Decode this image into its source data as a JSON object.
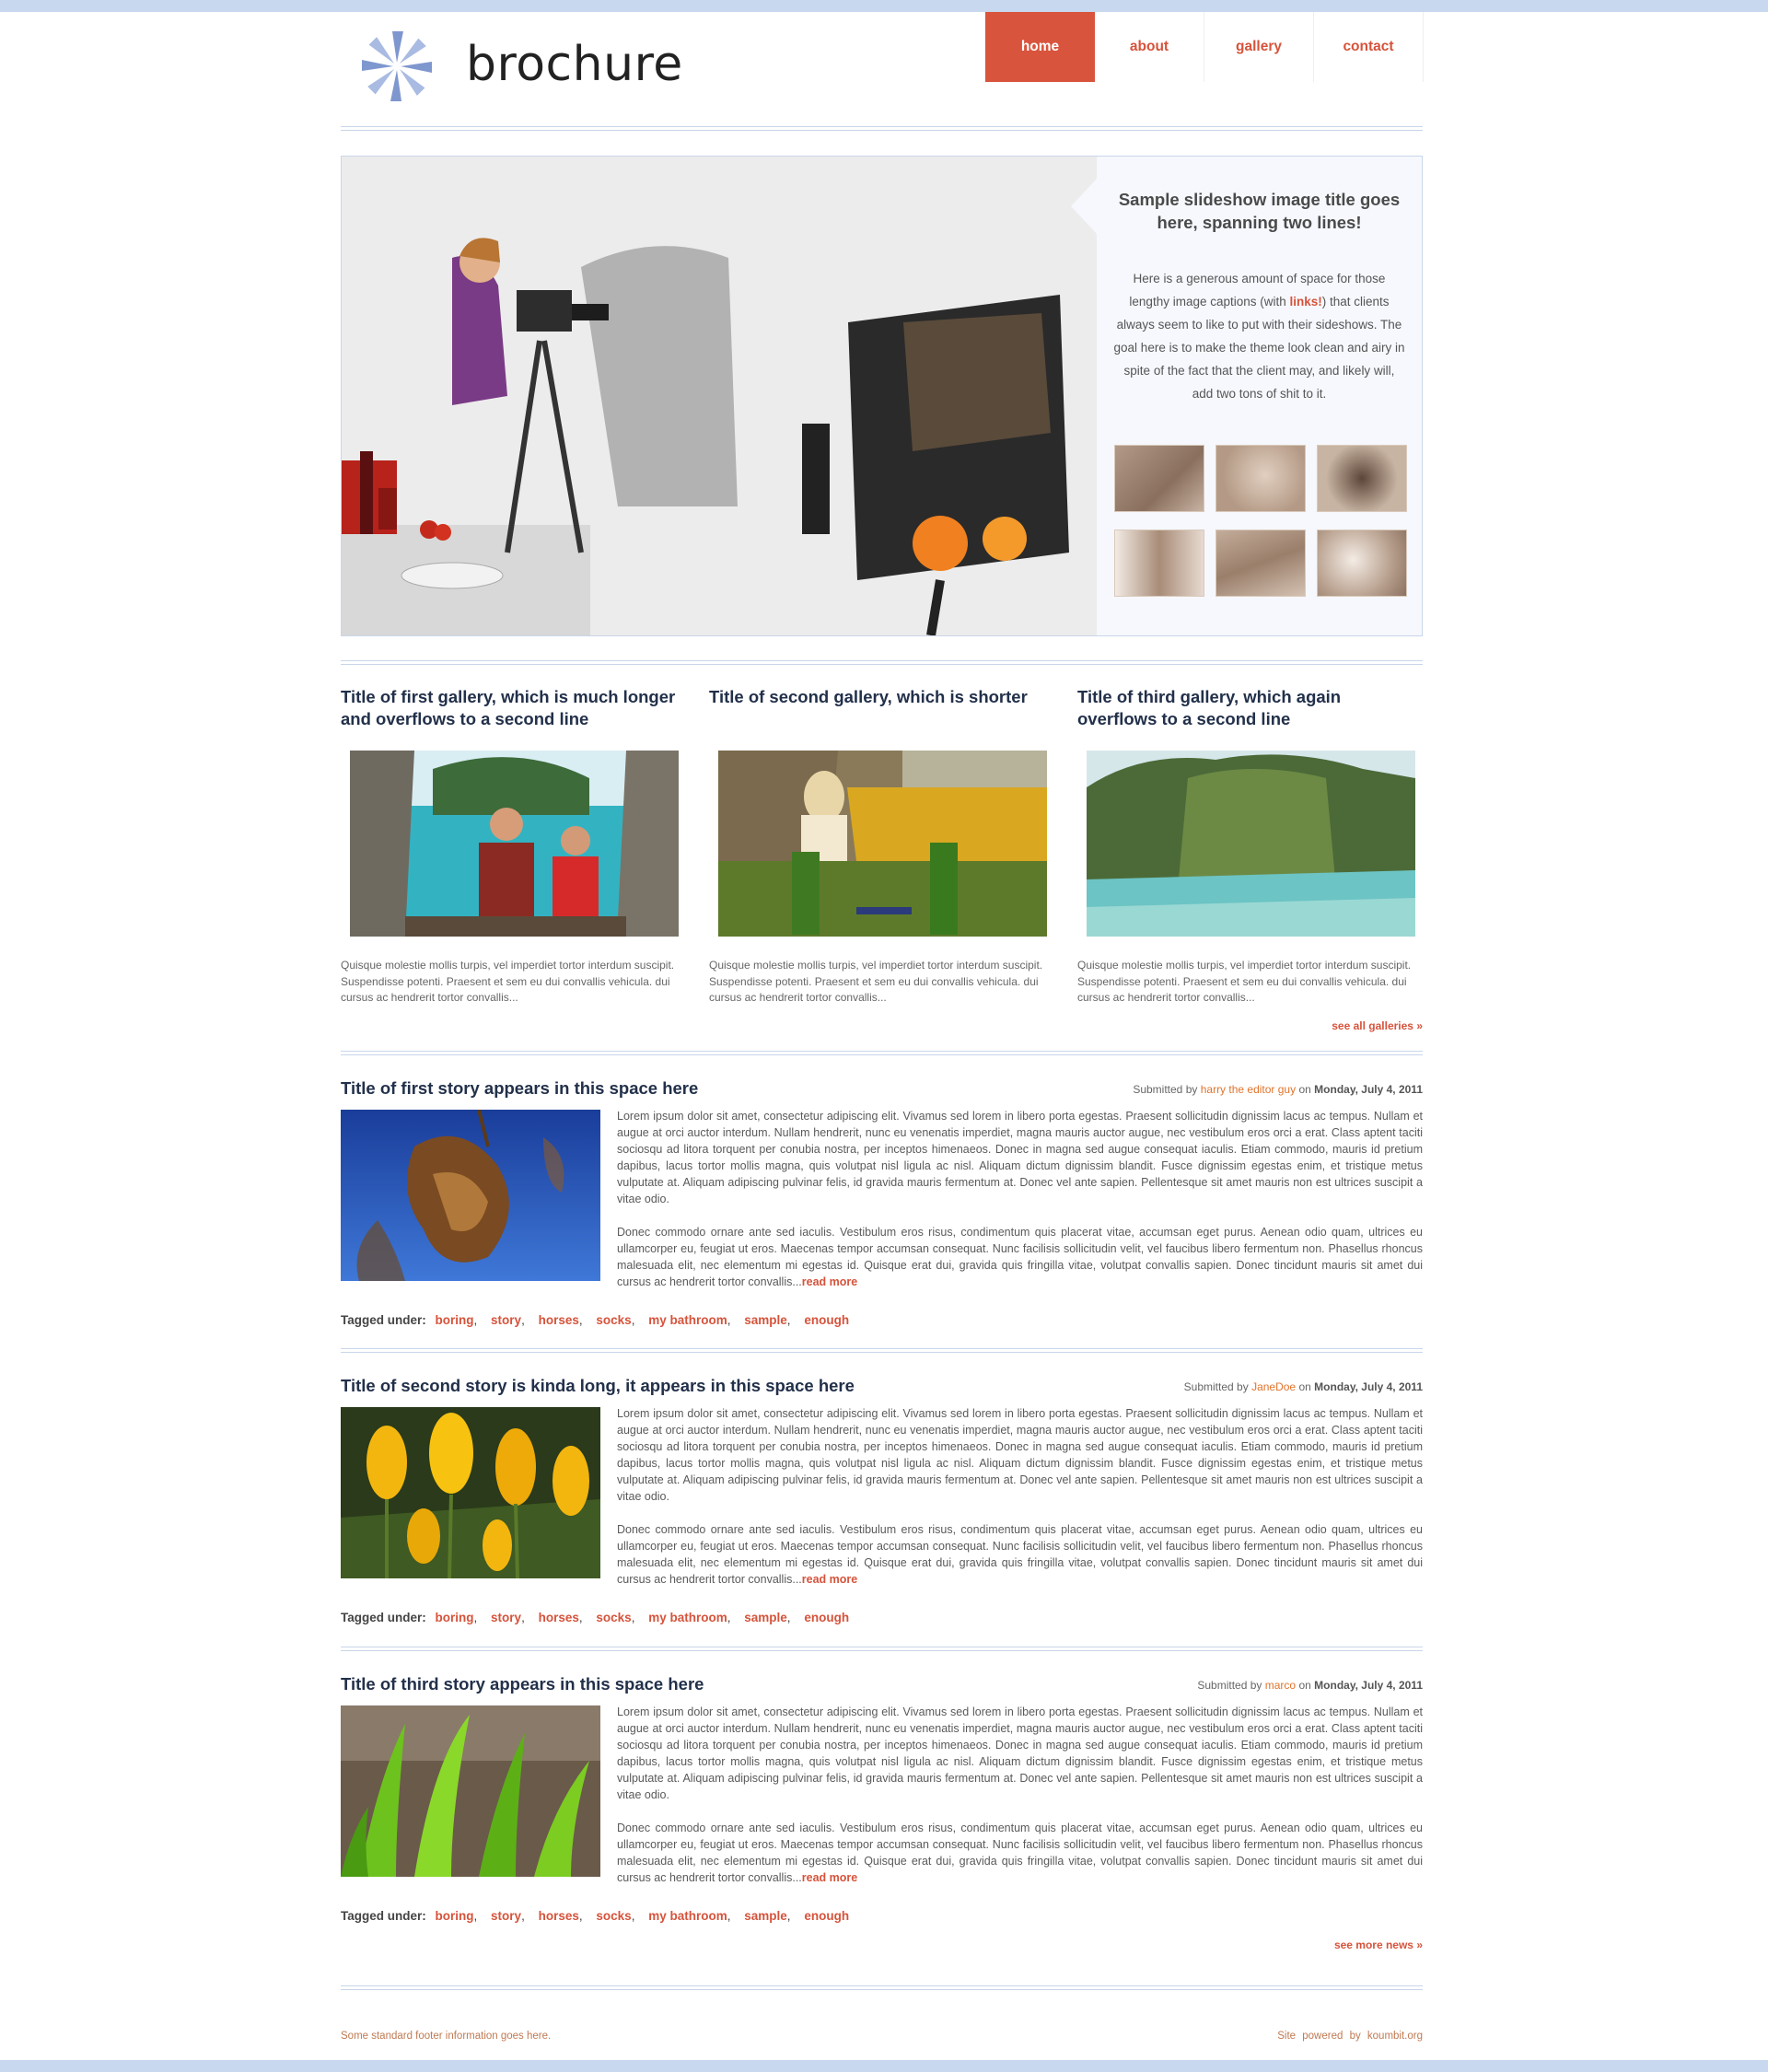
{
  "site": {
    "name": "brochure",
    "accent": "#d9543d",
    "bar_color": "#c8d8ee",
    "logo_icon": "pinwheel-logo-icon"
  },
  "nav": {
    "items": [
      {
        "label": "home",
        "active": true
      },
      {
        "label": "about"
      },
      {
        "label": "gallery"
      },
      {
        "label": "contact"
      }
    ]
  },
  "hero": {
    "title": "Sample slideshow image title goes here, spanning two lines!",
    "caption_pre": "Here is a generous amount of space for those lengthy image captions (with ",
    "caption_link": "links!",
    "caption_post": ") that clients always seem to like to put with their sideshows. The goal here is to make the theme look clean and airy in spite of the fact that the client may, and likely will, add two tons of shit to it."
  },
  "galleries": [
    {
      "title": "Title of first gallery, which is much longer and overflows to a second line",
      "text": "Quisque molestie mollis turpis, vel imperdiet tortor interdum suscipit. Suspendisse potenti. Praesent et sem eu dui convallis vehicula. dui cursus ac hendrerit tortor convallis..."
    },
    {
      "title": "Title of second gallery, which is shorter",
      "text": "Quisque molestie mollis turpis, vel imperdiet tortor interdum suscipit. Suspendisse potenti. Praesent et sem eu dui convallis vehicula. dui cursus ac hendrerit tortor convallis..."
    },
    {
      "title": "Title of third gallery, which again overflows to a second line",
      "text": "Quisque molestie mollis turpis, vel imperdiet tortor interdum suscipit. Suspendisse potenti. Praesent et sem eu dui convallis vehicula. dui cursus ac hendrerit tortor convallis..."
    }
  ],
  "see_all_galleries": "see all galleries »",
  "stories": [
    {
      "title": "Title of first story appears in this space here",
      "submitted": "Submitted by",
      "author": "harry the editor guy",
      "on": "on",
      "date": "Monday, July 4, 2011",
      "p1": "Lorem ipsum dolor sit amet, consectetur adipiscing elit. Vivamus sed lorem in libero porta egestas. Praesent sollicitudin dignissim lacus ac tempus. Nullam et augue at orci auctor interdum. Nullam hendrerit, nunc eu venenatis imperdiet, magna mauris auctor augue, nec vestibulum eros orci a erat. Class aptent taciti sociosqu ad litora torquent per conubia nostra, per inceptos himenaeos. Donec in magna sed augue consequat iaculis. Etiam commodo, mauris id pretium dapibus, lacus tortor mollis magna, quis volutpat nisl ligula ac nisl. Aliquam dictum dignissim blandit. Fusce dignissim egestas enim, et tristique metus vulputate at. Aliquam adipiscing pulvinar felis, id gravida mauris fermentum at. Donec vel ante sapien. Pellentesque sit amet mauris non est ultrices suscipit a vitae odio.",
      "p2": "Donec commodo ornare ante sed iaculis. Vestibulum eros risus, condimentum quis placerat vitae, accumsan eget purus. Aenean odio quam, ultrices eu ullamcorper eu, feugiat ut eros. Maecenas tempor accumsan consequat. Nunc facilisis sollicitudin velit, vel faucibus libero fermentum non. Phasellus rhoncus malesuada elit, nec elementum mi egestas id. Quisque erat dui, gravida quis fringilla vitae, volutpat convallis sapien. Donec tincidunt mauris sit amet dui cursus ac hendrerit tortor convallis...",
      "read_more": "read more"
    },
    {
      "title": "Title of second story is kinda long, it appears in this space here",
      "submitted": "Submitted by",
      "author": "JaneDoe",
      "on": "on",
      "date": "Monday, July 4, 2011",
      "p1": "Lorem ipsum dolor sit amet, consectetur adipiscing elit. Vivamus sed lorem in libero porta egestas. Praesent sollicitudin dignissim lacus ac tempus. Nullam et augue at orci auctor interdum. Nullam hendrerit, nunc eu venenatis imperdiet, magna mauris auctor augue, nec vestibulum eros orci a erat. Class aptent taciti sociosqu ad litora torquent per conubia nostra, per inceptos himenaeos. Donec in magna sed augue consequat iaculis. Etiam commodo, mauris id pretium dapibus, lacus tortor mollis magna, quis volutpat nisl ligula ac nisl. Aliquam dictum dignissim blandit. Fusce dignissim egestas enim, et tristique metus vulputate at. Aliquam adipiscing pulvinar felis, id gravida mauris fermentum at. Donec vel ante sapien. Pellentesque sit amet mauris non est ultrices suscipit a vitae odio.",
      "p2": "Donec commodo ornare ante sed iaculis. Vestibulum eros risus, condimentum quis placerat vitae, accumsan eget purus. Aenean odio quam, ultrices eu ullamcorper eu, feugiat ut eros. Maecenas tempor accumsan consequat. Nunc facilisis sollicitudin velit, vel faucibus libero fermentum non. Phasellus rhoncus malesuada elit, nec elementum mi egestas id. Quisque erat dui, gravida quis fringilla vitae, volutpat convallis sapien. Donec tincidunt mauris sit amet dui cursus ac hendrerit tortor convallis...",
      "read_more": "read more"
    },
    {
      "title": "Title of third story appears in this space here",
      "submitted": "Submitted by",
      "author": "marco",
      "on": "on",
      "date": "Monday, July 4, 2011",
      "p1": "Lorem ipsum dolor sit amet, consectetur adipiscing elit. Vivamus sed lorem in libero porta egestas. Praesent sollicitudin dignissim lacus ac tempus. Nullam et augue at orci auctor interdum. Nullam hendrerit, nunc eu venenatis imperdiet, magna mauris auctor augue, nec vestibulum eros orci a erat. Class aptent taciti sociosqu ad litora torquent per conubia nostra, per inceptos himenaeos. Donec in magna sed augue consequat iaculis. Etiam commodo, mauris id pretium dapibus, lacus tortor mollis magna, quis volutpat nisl ligula ac nisl. Aliquam dictum dignissim blandit. Fusce dignissim egestas enim, et tristique metus vulputate at. Aliquam adipiscing pulvinar felis, id gravida mauris fermentum at. Donec vel ante sapien. Pellentesque sit amet mauris non est ultrices suscipit a vitae odio.",
      "p2": "Donec commodo ornare ante sed iaculis. Vestibulum eros risus, condimentum quis placerat vitae, accumsan eget purus. Aenean odio quam, ultrices eu ullamcorper eu, feugiat ut eros. Maecenas tempor accumsan consequat. Nunc facilisis sollicitudin velit, vel faucibus libero fermentum non. Phasellus rhoncus malesuada elit, nec elementum mi egestas id. Quisque erat dui, gravida quis fringilla vitae, volutpat convallis sapien. Donec tincidunt mauris sit amet dui cursus ac hendrerit tortor convallis...",
      "read_more": "read more"
    }
  ],
  "tags": {
    "label": "Tagged under:",
    "items": [
      "boring",
      "story",
      "horses",
      "socks",
      "my bathroom",
      "sample",
      "enough"
    ]
  },
  "see_more_news": "see more news »",
  "footer": {
    "left": "Some standard footer information goes here.",
    "right": "Site powered by koumbit.org"
  }
}
